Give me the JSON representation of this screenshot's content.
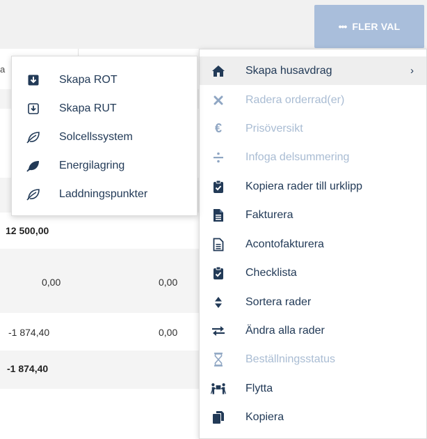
{
  "toolbar": {
    "more_choices_label": "FLER VAL"
  },
  "table": {
    "stub_text": "a",
    "total_row": {
      "amount": "12 500,00"
    },
    "row_zero": {
      "col1": "0,00",
      "col2": "0,00"
    },
    "row_deduction": {
      "col1": "-1 874,40",
      "col2": "0,00"
    },
    "row_deduction_total": {
      "col1": "-1 874,40"
    }
  },
  "main_menu": {
    "items": [
      {
        "label": "Skapa husavdrag",
        "icon": "home-icon",
        "state": "active",
        "has_submenu": true
      },
      {
        "label": "Radera orderrad(er)",
        "icon": "close-icon",
        "state": "disabled"
      },
      {
        "label": "Prisöversikt",
        "icon": "euro-icon",
        "state": "disabled"
      },
      {
        "label": "Infoga delsummering",
        "icon": "divide-icon",
        "state": "disabled"
      },
      {
        "label": "Kopiera rader till urklipp",
        "icon": "clipboard-check-icon",
        "state": "enabled"
      },
      {
        "label": "Fakturera",
        "icon": "invoice-icon",
        "state": "enabled"
      },
      {
        "label": "Acontofakturera",
        "icon": "invoice-outline-icon",
        "state": "enabled"
      },
      {
        "label": "Checklista",
        "icon": "checklist-icon",
        "state": "enabled"
      },
      {
        "label": "Sortera rader",
        "icon": "sort-icon",
        "state": "enabled"
      },
      {
        "label": "Ändra alla rader",
        "icon": "exchange-icon",
        "state": "enabled"
      },
      {
        "label": "Beställningsstatus",
        "icon": "hourglass-icon",
        "state": "disabled"
      },
      {
        "label": "Flytta",
        "icon": "people-carry-icon",
        "state": "enabled"
      },
      {
        "label": "Kopiera",
        "icon": "copy-icon",
        "state": "enabled"
      }
    ]
  },
  "sub_menu": {
    "items": [
      {
        "label": "Skapa ROT",
        "icon": "download-box-icon"
      },
      {
        "label": "Skapa RUT",
        "icon": "download-box-outline-icon"
      },
      {
        "label": "Solcellssystem",
        "icon": "leaf-outline-icon"
      },
      {
        "label": "Energilagring",
        "icon": "leaf-icon"
      },
      {
        "label": "Laddningspunkter",
        "icon": "leaf-outline-icon"
      }
    ]
  },
  "colors": {
    "menu_text": "#223a57",
    "menu_text_disabled": "#a9bcd3",
    "button_bg": "#a9bedb",
    "active_row_bg": "#eeeeee"
  }
}
